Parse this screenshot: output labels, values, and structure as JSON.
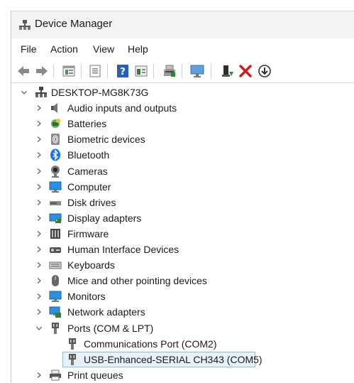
{
  "window": {
    "title": "Device Manager"
  },
  "menu": [
    "File",
    "Action",
    "View",
    "Help"
  ],
  "toolbar": {
    "buttons": [
      "back-icon",
      "forward-icon",
      "properties-icon",
      "show-hidden-icon",
      "help-icon",
      "view-icon",
      "scan-icon",
      "monitor-icon",
      "update-driver-icon",
      "uninstall-icon",
      "download-icon"
    ],
    "colors": {
      "uninstall": "#d11a1a",
      "help": "#2a5fb5",
      "update": "#2e8a2e"
    }
  },
  "tree": {
    "root": "DESKTOP-MG8K73G",
    "categories": [
      {
        "label": "Audio inputs and outputs",
        "icon": "speaker-icon"
      },
      {
        "label": "Batteries",
        "icon": "battery-icon"
      },
      {
        "label": "Biometric devices",
        "icon": "fingerprint-icon"
      },
      {
        "label": "Bluetooth",
        "icon": "bluetooth-icon"
      },
      {
        "label": "Cameras",
        "icon": "camera-icon"
      },
      {
        "label": "Computer",
        "icon": "computer-icon"
      },
      {
        "label": "Disk drives",
        "icon": "disk-drive-icon"
      },
      {
        "label": "Display adapters",
        "icon": "display-adapter-icon"
      },
      {
        "label": "Firmware",
        "icon": "firmware-icon"
      },
      {
        "label": "Human Interface Devices",
        "icon": "hid-icon"
      },
      {
        "label": "Keyboards",
        "icon": "keyboard-icon"
      },
      {
        "label": "Mice and other pointing devices",
        "icon": "mouse-icon"
      },
      {
        "label": "Monitors",
        "icon": "monitor-icon"
      },
      {
        "label": "Network adapters",
        "icon": "network-icon"
      },
      {
        "label": "Ports (COM & LPT)",
        "icon": "port-icon",
        "expanded": true,
        "children": [
          {
            "label": "Communications Port (COM2)",
            "icon": "port-icon"
          },
          {
            "label": "USB-Enhanced-SERIAL CH343 (COM5)",
            "icon": "port-icon",
            "selected": true
          }
        ]
      },
      {
        "label": "Print queues",
        "icon": "printer-icon"
      }
    ]
  }
}
